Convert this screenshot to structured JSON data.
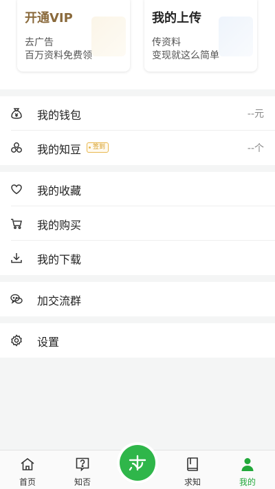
{
  "cards": {
    "vip": {
      "title": "开通VIP",
      "line1": "去广告",
      "line2": "百万资料免费领"
    },
    "upload": {
      "title": "我的上传",
      "line1": "传资料",
      "line2": "变现就这么简单"
    }
  },
  "menu": {
    "wallet": {
      "label": "我的钱包",
      "value": "--元",
      "icon": "money-bag-icon"
    },
    "beans": {
      "label": "我的知豆",
      "value": "--个",
      "badge": "签到",
      "icon": "beans-icon"
    },
    "favorites": {
      "label": "我的收藏",
      "icon": "heart-icon"
    },
    "purchases": {
      "label": "我的购买",
      "icon": "cart-icon"
    },
    "downloads": {
      "label": "我的下载",
      "icon": "download-icon"
    },
    "group": {
      "label": "加交流群",
      "icon": "chat-icon"
    },
    "settings": {
      "label": "设置",
      "icon": "gear-icon"
    }
  },
  "tabs": {
    "home": "首页",
    "zhifou": "知否",
    "qiuzhi": "求知",
    "mine": "我的",
    "center_icon": "center-logo-icon"
  },
  "colors": {
    "accent": "#22a83a",
    "vip_gold": "#8a6a3c",
    "badge": "#d49a1e"
  }
}
